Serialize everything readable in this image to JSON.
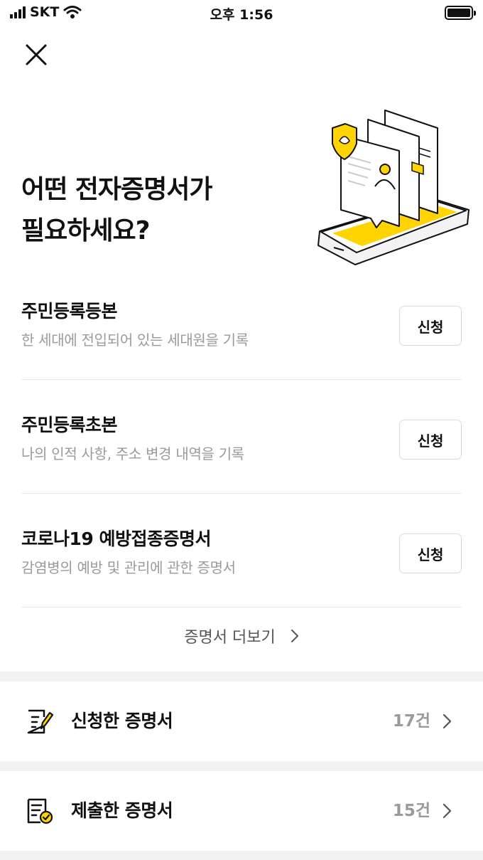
{
  "status_bar": {
    "carrier": "SKT",
    "time": "오후 1:56"
  },
  "header": {
    "close_icon": "close-icon"
  },
  "hero": {
    "headline_highlight": "어떤 전자증명서",
    "headline_rest": "가",
    "headline_line2": "필요하세요?",
    "accent_color": "#ffd400"
  },
  "certificates": [
    {
      "title": "주민등록등본",
      "description": "한 세대에 전입되어 있는 세대원을 기록",
      "button": "신청"
    },
    {
      "title": "주민등록초본",
      "description": "나의 인적 사항, 주소 변경 내역을 기록",
      "button": "신청"
    },
    {
      "title": "코로나19 예방접종증명서",
      "description": "감염병의 예방 및 관리에 관한 증명서",
      "button": "신청"
    }
  ],
  "more_link": {
    "label": "증명서 더보기"
  },
  "applied": {
    "label": "신청한 증명서",
    "count": "17건",
    "icon": "edit-document-icon"
  },
  "submitted": {
    "label": "제출한 증명서",
    "count": "15건",
    "icon": "check-document-icon"
  }
}
